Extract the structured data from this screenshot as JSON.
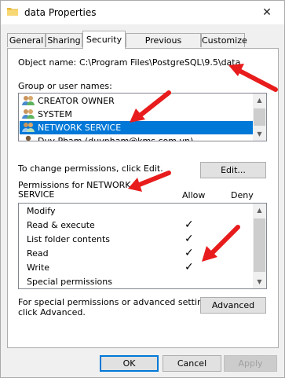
{
  "window": {
    "title": "data Properties",
    "close_glyph": "✕"
  },
  "tabs": [
    {
      "label": "General"
    },
    {
      "label": "Sharing"
    },
    {
      "label": "Security"
    },
    {
      "label": "Previous Versions"
    },
    {
      "label": "Customize"
    }
  ],
  "object": {
    "label": "Object name:",
    "value": "C:\\Program Files\\PostgreSQL\\9.5\\data"
  },
  "groups": {
    "label": "Group or user names:",
    "items": [
      {
        "name": "CREATOR OWNER",
        "icon": "users-icon"
      },
      {
        "name": "SYSTEM",
        "icon": "users-icon"
      },
      {
        "name": "NETWORK SERVICE",
        "icon": "users-icon",
        "selected": true
      },
      {
        "name": "Duy Pham (duypham@kms.com.vn)",
        "icon": "user-icon"
      }
    ]
  },
  "edit": {
    "hint": "To change permissions, click Edit.",
    "button": "Edit..."
  },
  "permissions": {
    "title_line1": "Permissions for NETWORK",
    "title_line2": "SERVICE",
    "allow_header": "Allow",
    "deny_header": "Deny",
    "rows": [
      {
        "name": "Modify",
        "allow": false,
        "deny": false
      },
      {
        "name": "Read & execute",
        "allow": true,
        "deny": false
      },
      {
        "name": "List folder contents",
        "allow": true,
        "deny": false
      },
      {
        "name": "Read",
        "allow": true,
        "deny": false
      },
      {
        "name": "Write",
        "allow": true,
        "deny": false
      },
      {
        "name": "Special permissions",
        "allow": false,
        "deny": false
      }
    ],
    "check_glyph": "✓"
  },
  "advanced": {
    "hint_line1": "For special permissions or advanced settings,",
    "hint_line2": "click Advanced.",
    "button": "Advanced"
  },
  "footer": {
    "ok": "OK",
    "cancel": "Cancel",
    "apply": "Apply"
  },
  "colors": {
    "accent": "#0078d7",
    "arrow": "#e81c1c"
  }
}
